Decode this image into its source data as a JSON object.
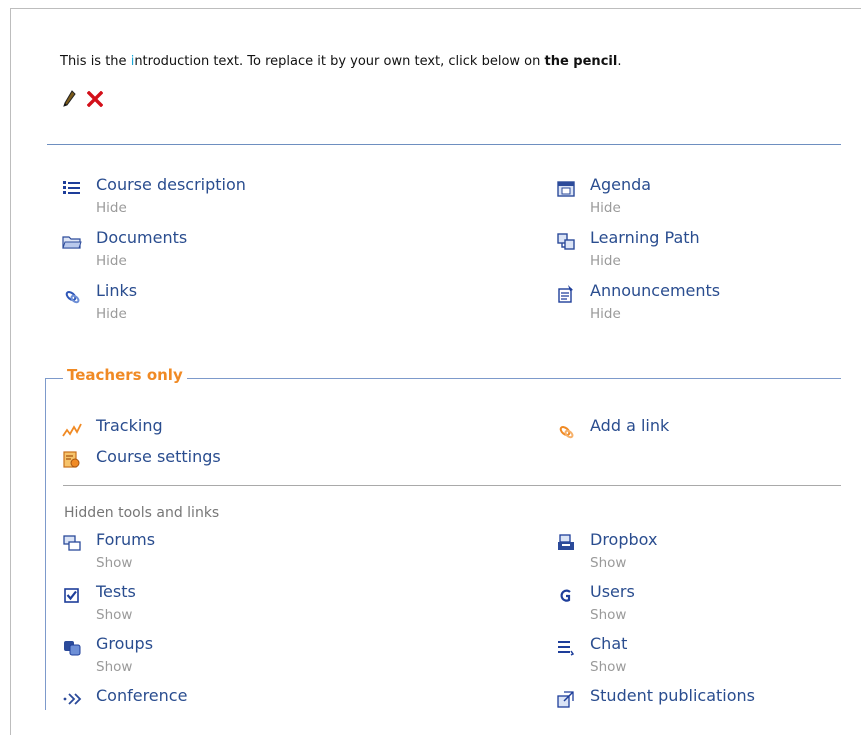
{
  "intro": {
    "text_before": "This is the ",
    "text_highlight": "i",
    "text_middle": "ntroduction text. To replace it by your own text, click below on ",
    "text_bold": "the pencil",
    "text_after": ".",
    "edit_icon": "pencil-icon",
    "delete_icon": "delete-x-icon"
  },
  "tools_public": [
    {
      "name": "Course description",
      "action": "Hide",
      "icon": "list-icon"
    },
    {
      "name": "Agenda",
      "action": "Hide",
      "icon": "calendar-icon"
    },
    {
      "name": "Documents",
      "action": "Hide",
      "icon": "folder-icon"
    },
    {
      "name": "Learning Path",
      "action": "Hide",
      "icon": "learning-path-icon"
    },
    {
      "name": "Links",
      "action": "Hide",
      "icon": "link-icon"
    },
    {
      "name": "Announcements",
      "action": "Hide",
      "icon": "announcement-icon"
    }
  ],
  "teachers": {
    "legend": "Teachers only",
    "tools": [
      {
        "name": "Tracking",
        "icon": "tracking-icon"
      },
      {
        "name": "Add a link",
        "icon": "add-link-icon"
      },
      {
        "name": "Course settings",
        "icon": "settings-icon"
      }
    ],
    "hidden_label": "Hidden tools and links",
    "hidden_tools": [
      {
        "name": "Forums",
        "action": "Show",
        "icon": "forum-icon"
      },
      {
        "name": "Dropbox",
        "action": "Show",
        "icon": "dropbox-icon"
      },
      {
        "name": "Tests",
        "action": "Show",
        "icon": "tests-icon"
      },
      {
        "name": "Users",
        "action": "Show",
        "icon": "users-icon"
      },
      {
        "name": "Groups",
        "action": "Show",
        "icon": "groups-icon"
      },
      {
        "name": "Chat",
        "action": "Show",
        "icon": "chat-icon"
      },
      {
        "name": "Conference",
        "action": "",
        "icon": "conference-icon"
      },
      {
        "name": "Student publications",
        "action": "",
        "icon": "publications-icon"
      }
    ]
  },
  "colors": {
    "link": "#2a4d8f",
    "muted": "#9a9a9a",
    "accent_orange": "#f08a24",
    "separator_blue": "#6e8fc0"
  }
}
